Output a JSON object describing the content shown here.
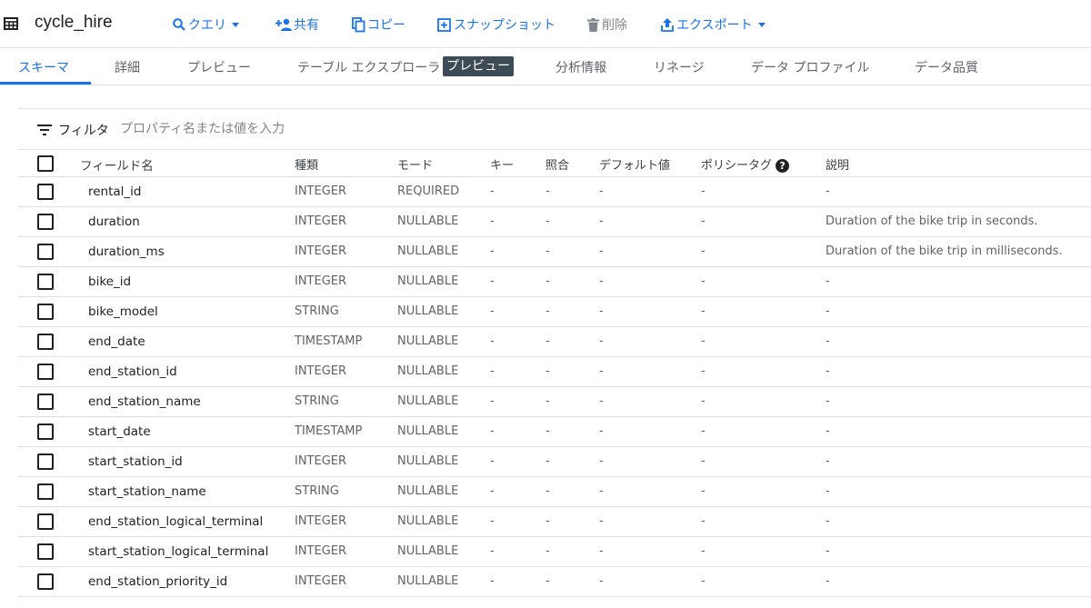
{
  "toolbar": {
    "title": "cycle_hire",
    "query_label": "クエリ",
    "share_label": "共有",
    "copy_label": "コピー",
    "snapshot_label": "スナップショット",
    "delete_label": "削除",
    "export_label": "エクスポート"
  },
  "tabs": {
    "schema": "スキーマ",
    "details": "詳細",
    "preview": "プレビュー",
    "table_explorer": "テーブル エクスプローラ",
    "table_explorer_badge": "プレビュー",
    "insights": "分析情報",
    "lineage": "リネージ",
    "data_profile": "データ プロファイル",
    "data_quality": "データ品質"
  },
  "filter": {
    "label": "フィルタ",
    "placeholder": "プロパティ名または値を入力"
  },
  "table": {
    "headers": {
      "field": "フィールド名",
      "type": "種類",
      "mode": "モード",
      "key": "キー",
      "collation": "照合",
      "default": "デフォルト値",
      "policy": "ポリシータグ",
      "description": "説明"
    },
    "rows": [
      {
        "name": "rental_id",
        "type": "INTEGER",
        "mode": "REQUIRED",
        "key": "-",
        "collation": "-",
        "default": "-",
        "policy": "-",
        "description": "-"
      },
      {
        "name": "duration",
        "type": "INTEGER",
        "mode": "NULLABLE",
        "key": "-",
        "collation": "-",
        "default": "-",
        "policy": "-",
        "description": "Duration of the bike trip in seconds."
      },
      {
        "name": "duration_ms",
        "type": "INTEGER",
        "mode": "NULLABLE",
        "key": "-",
        "collation": "-",
        "default": "-",
        "policy": "-",
        "description": "Duration of the bike trip in milliseconds."
      },
      {
        "name": "bike_id",
        "type": "INTEGER",
        "mode": "NULLABLE",
        "key": "-",
        "collation": "-",
        "default": "-",
        "policy": "-",
        "description": "-"
      },
      {
        "name": "bike_model",
        "type": "STRING",
        "mode": "NULLABLE",
        "key": "-",
        "collation": "-",
        "default": "-",
        "policy": "-",
        "description": "-"
      },
      {
        "name": "end_date",
        "type": "TIMESTAMP",
        "mode": "NULLABLE",
        "key": "-",
        "collation": "-",
        "default": "-",
        "policy": "-",
        "description": "-"
      },
      {
        "name": "end_station_id",
        "type": "INTEGER",
        "mode": "NULLABLE",
        "key": "-",
        "collation": "-",
        "default": "-",
        "policy": "-",
        "description": "-"
      },
      {
        "name": "end_station_name",
        "type": "STRING",
        "mode": "NULLABLE",
        "key": "-",
        "collation": "-",
        "default": "-",
        "policy": "-",
        "description": "-"
      },
      {
        "name": "start_date",
        "type": "TIMESTAMP",
        "mode": "NULLABLE",
        "key": "-",
        "collation": "-",
        "default": "-",
        "policy": "-",
        "description": "-"
      },
      {
        "name": "start_station_id",
        "type": "INTEGER",
        "mode": "NULLABLE",
        "key": "-",
        "collation": "-",
        "default": "-",
        "policy": "-",
        "description": "-"
      },
      {
        "name": "start_station_name",
        "type": "STRING",
        "mode": "NULLABLE",
        "key": "-",
        "collation": "-",
        "default": "-",
        "policy": "-",
        "description": "-"
      },
      {
        "name": "end_station_logical_terminal",
        "type": "INTEGER",
        "mode": "NULLABLE",
        "key": "-",
        "collation": "-",
        "default": "-",
        "policy": "-",
        "description": "-"
      },
      {
        "name": "start_station_logical_terminal",
        "type": "INTEGER",
        "mode": "NULLABLE",
        "key": "-",
        "collation": "-",
        "default": "-",
        "policy": "-",
        "description": "-"
      },
      {
        "name": "end_station_priority_id",
        "type": "INTEGER",
        "mode": "NULLABLE",
        "key": "-",
        "collation": "-",
        "default": "-",
        "policy": "-",
        "description": "-"
      }
    ]
  },
  "colors": {
    "accent": "#1a73e8",
    "disabled": "#80868b",
    "badge_bg": "#3c4b56"
  }
}
